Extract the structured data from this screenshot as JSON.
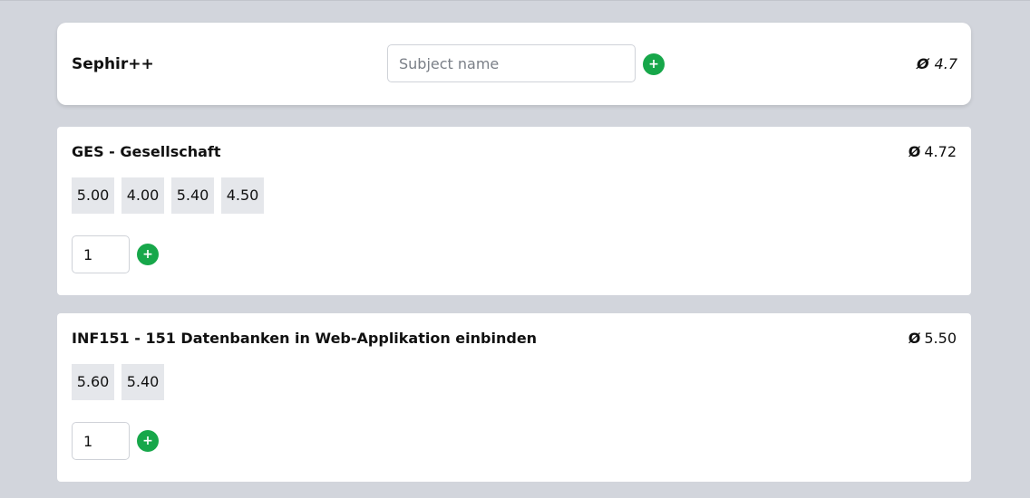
{
  "header": {
    "app_title": "Sephir++",
    "subject_input_placeholder": "Subject name",
    "add_label": "+",
    "avg_symbol": "Ø",
    "overall_average": "4.7"
  },
  "subjects": [
    {
      "title": "GES - Gesellschaft",
      "avg_symbol": "Ø",
      "average": "4.72",
      "grades": [
        "5.00",
        "4.00",
        "5.40",
        "4.50"
      ],
      "weight_value": "1",
      "add_label": "+"
    },
    {
      "title": "INF151 - 151 Datenbanken in Web-Applikation einbinden",
      "avg_symbol": "Ø",
      "average": "5.50",
      "grades": [
        "5.60",
        "5.40"
      ],
      "weight_value": "1",
      "add_label": "+"
    }
  ],
  "colors": {
    "page_background": "#d2d5dc",
    "card_background": "#ffffff",
    "grade_chip": "#e5e7eb",
    "add_button": "#17a74a"
  },
  "icons": {
    "add": "plus-icon"
  }
}
